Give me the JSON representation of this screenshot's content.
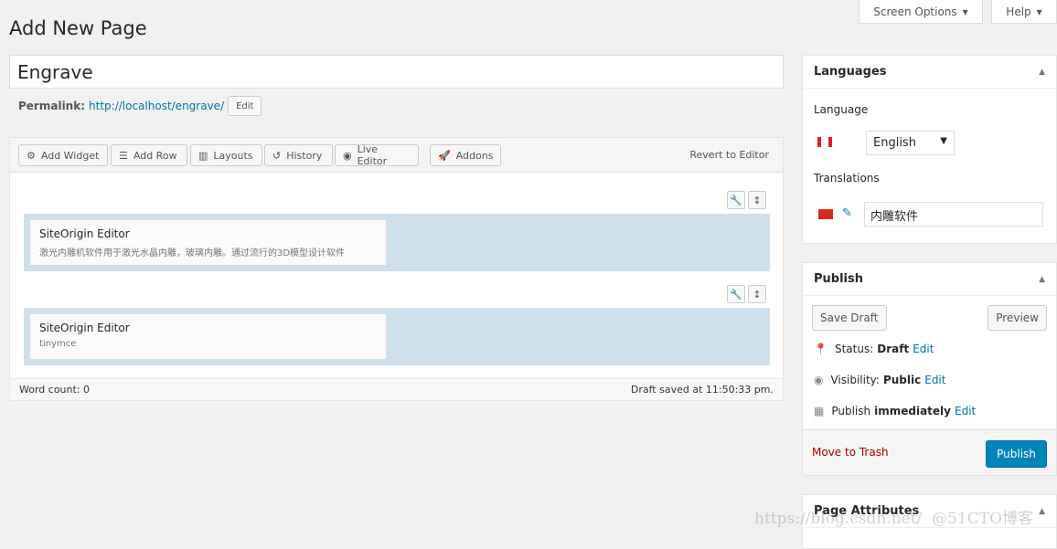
{
  "header": {
    "screen_options": "Screen Options",
    "help": "Help",
    "title": "Add New Page"
  },
  "post": {
    "title": "Engrave",
    "permalink_label": "Permalink:",
    "permalink_url": "http://localhost/engrave/",
    "edit": "Edit"
  },
  "toolbar": {
    "add_widget": "Add Widget",
    "add_row": "Add Row",
    "layouts": "Layouts",
    "history": "History",
    "live_editor": "Live Editor",
    "addons": "Addons",
    "revert": "Revert to Editor"
  },
  "rows": [
    {
      "title": "SiteOrigin Editor",
      "desc": "激光内雕机软件用于激光水晶内雕，玻璃内雕。通过流行的3D模型设计软件"
    },
    {
      "title": "SiteOrigin Editor",
      "desc": "tinymce"
    }
  ],
  "footer": {
    "word_count": "Word count: 0",
    "draft_saved": "Draft saved at 11:50:33 pm."
  },
  "languages": {
    "title": "Languages",
    "language_label": "Language",
    "language_value": "English",
    "translations_label": "Translations",
    "translation_value": "内雕软件"
  },
  "publish": {
    "title": "Publish",
    "save_draft": "Save Draft",
    "preview": "Preview",
    "status_label": "Status:",
    "status_value": "Draft",
    "visibility_label": "Visibility:",
    "visibility_value": "Public",
    "publish_label": "Publish",
    "publish_value": "immediately",
    "edit": "Edit",
    "trash": "Move to Trash",
    "publish_btn": "Publish"
  },
  "page_attributes": {
    "title": "Page Attributes"
  },
  "watermark": "https://blog.csdn.net/  @51CTO博客",
  "colors": {
    "primary": "#0085ba",
    "link": "#0073aa",
    "trash": "#a00",
    "row_bg": "#cde0ec"
  }
}
